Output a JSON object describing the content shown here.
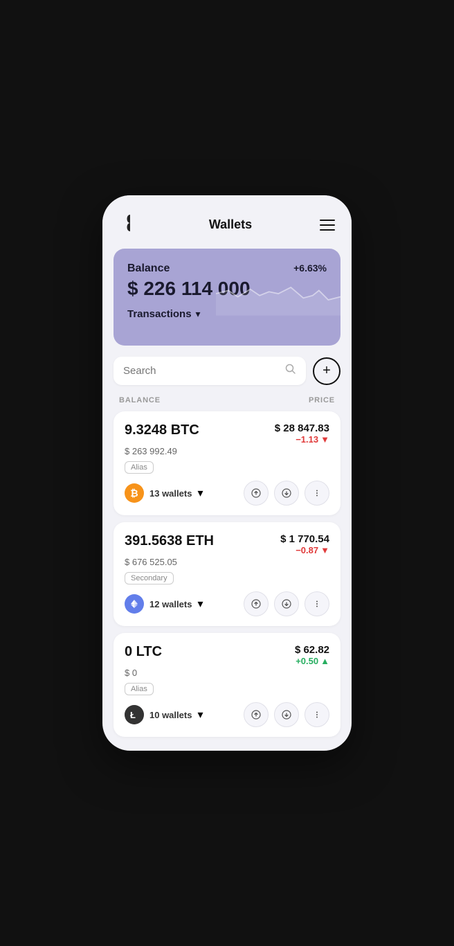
{
  "header": {
    "title": "Wallets",
    "menu_label": "menu"
  },
  "balance_card": {
    "balance_label": "Balance",
    "pct": "+6.63%",
    "amount": "$ 226 114 000",
    "transactions_label": "Transactions"
  },
  "search": {
    "placeholder": "Search",
    "add_button_label": "+"
  },
  "columns": {
    "balance": "BALANCE",
    "price": "PRICE"
  },
  "coins": [
    {
      "amount": "9.3248 BTC",
      "usd_value": "$ 263 992.49",
      "price": "$ 28 847.83",
      "change": "-1.13",
      "change_positive": false,
      "alias": "Alias",
      "wallets": "13 wallets",
      "logo_symbol": "₿",
      "logo_type": "btc"
    },
    {
      "amount": "391.5638 ETH",
      "usd_value": "$ 676 525.05",
      "price": "$ 1 770.54",
      "change": "-0.87",
      "change_positive": false,
      "alias": "Secondary",
      "wallets": "12 wallets",
      "logo_symbol": "⬨",
      "logo_type": "eth"
    },
    {
      "amount": "0 LTC",
      "usd_value": "$ 0",
      "price": "$ 62.82",
      "change": "+0.50",
      "change_positive": true,
      "alias": "Alias",
      "wallets": "10 wallets",
      "logo_symbol": "Ł",
      "logo_type": "ltc"
    }
  ]
}
